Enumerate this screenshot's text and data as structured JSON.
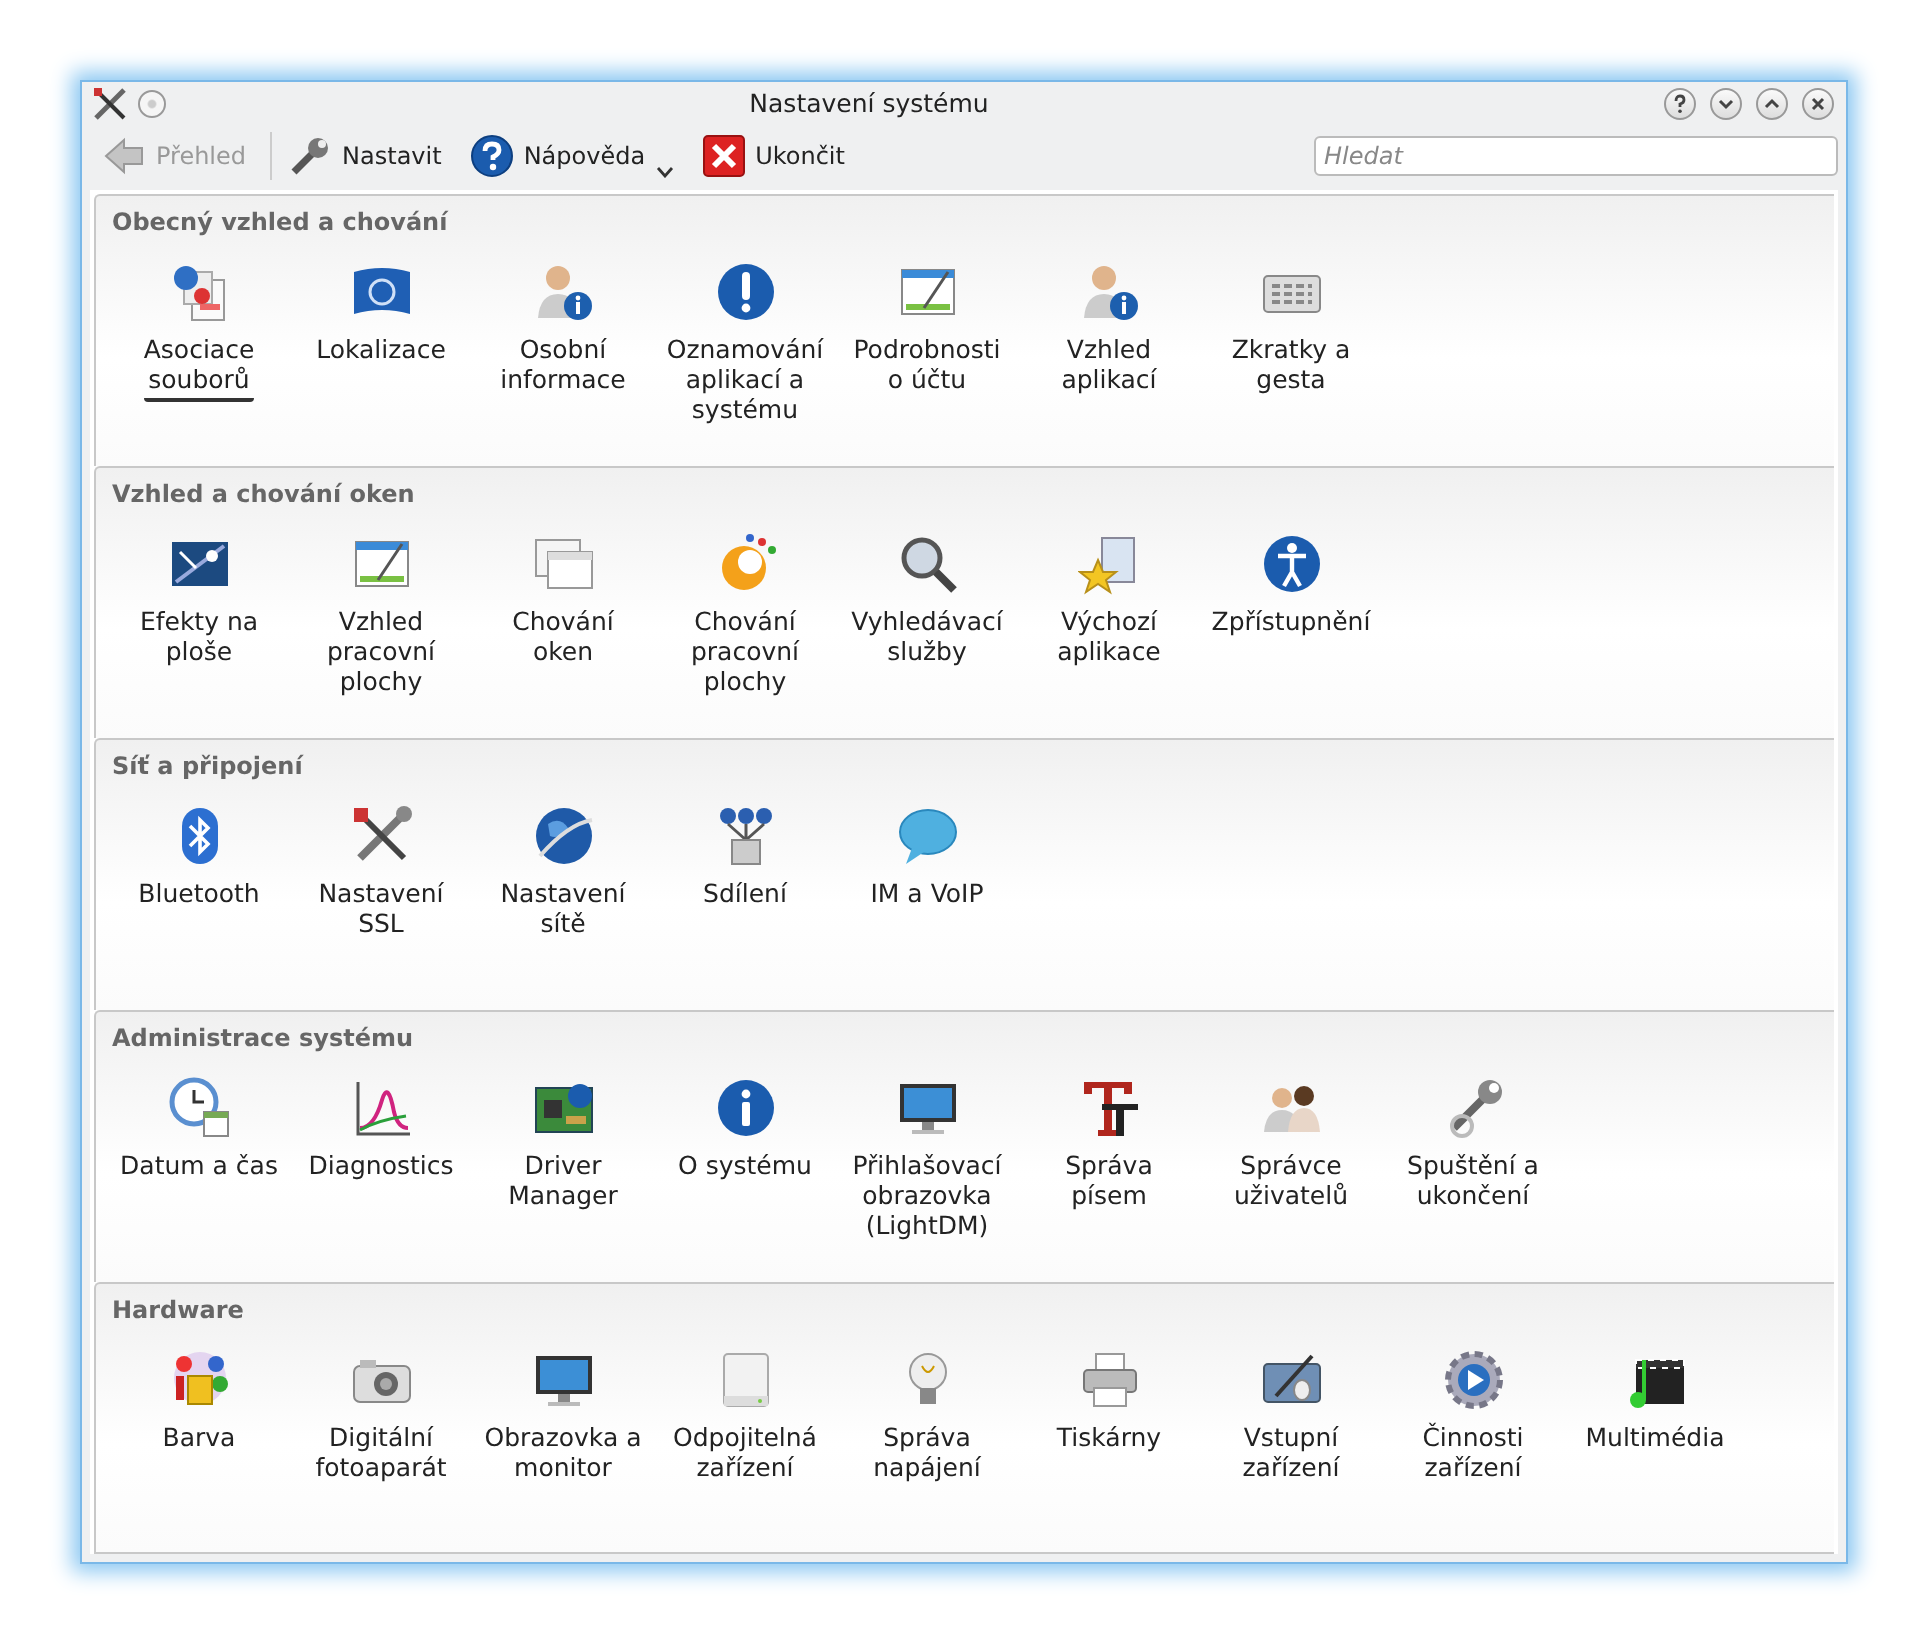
{
  "window": {
    "title": "Nastavení systému"
  },
  "toolbar": [
    {
      "kind": "back",
      "label": "Přehled",
      "disabled": true
    },
    {
      "kind": "configure",
      "label": "Nastavit",
      "disabled": false
    },
    {
      "kind": "help",
      "label": "Nápověda",
      "disabled": false,
      "dropdown": true
    },
    {
      "kind": "quit",
      "label": "Ukončit",
      "disabled": false
    }
  ],
  "search": {
    "placeholder": "Hledat"
  },
  "sections": [
    {
      "title": "Obecný vzhled a chování",
      "items": [
        {
          "label": "Asociace\nsouborů",
          "selected": true
        },
        {
          "label": "Lokalizace",
          "selected": false
        },
        {
          "label": "Osobní\ninformace",
          "selected": false
        },
        {
          "label": "Oznamování\naplikací a\nsystému",
          "selected": false
        },
        {
          "label": "Podrobnosti\no účtu",
          "selected": false
        },
        {
          "label": "Vzhled\naplikací",
          "selected": false
        },
        {
          "label": "Zkratky a\ngesta",
          "selected": false
        }
      ]
    },
    {
      "title": "Vzhled a chování oken",
      "items": [
        {
          "label": "Efekty na\nploše",
          "selected": false
        },
        {
          "label": "Vzhled\npracovní\nplochy",
          "selected": false
        },
        {
          "label": "Chování\noken",
          "selected": false
        },
        {
          "label": "Chování\npracovní\nplochy",
          "selected": false
        },
        {
          "label": "Vyhledávací\nslužby",
          "selected": false
        },
        {
          "label": "Výchozí\naplikace",
          "selected": false
        },
        {
          "label": "Zpřístupnění",
          "selected": false
        }
      ]
    },
    {
      "title": "Síť a připojení",
      "items": [
        {
          "label": "Bluetooth",
          "selected": false
        },
        {
          "label": "Nastavení\nSSL",
          "selected": false
        },
        {
          "label": "Nastavení\nsítě",
          "selected": false
        },
        {
          "label": "Sdílení",
          "selected": false
        },
        {
          "label": "IM a VoIP",
          "selected": false
        }
      ]
    },
    {
      "title": "Administrace systému",
      "items": [
        {
          "label": "Datum a čas",
          "selected": false
        },
        {
          "label": "Diagnostics",
          "selected": false
        },
        {
          "label": "Driver\nManager",
          "selected": false
        },
        {
          "label": "O systému",
          "selected": false
        },
        {
          "label": "Přihlašovací\nobrazovka\n(LightDM)",
          "selected": false
        },
        {
          "label": "Správa\npísem",
          "selected": false
        },
        {
          "label": "Správce\nuživatelů",
          "selected": false
        },
        {
          "label": "Spuštění a\nukončení",
          "selected": false
        }
      ]
    },
    {
      "title": "Hardware",
      "items": [
        {
          "label": "Barva",
          "selected": false
        },
        {
          "label": "Digitální\nfotoaparát",
          "selected": false
        },
        {
          "label": "Obrazovka a\nmonitor",
          "selected": false
        },
        {
          "label": "Odpojitelná\nzařízení",
          "selected": false
        },
        {
          "label": "Správa\nnapájení",
          "selected": false
        },
        {
          "label": "Tiskárny",
          "selected": false
        },
        {
          "label": "Vstupní\nzařízení",
          "selected": false
        },
        {
          "label": "Činnosti\nzařízení",
          "selected": false
        },
        {
          "label": "Multimédia",
          "selected": false
        }
      ]
    }
  ]
}
